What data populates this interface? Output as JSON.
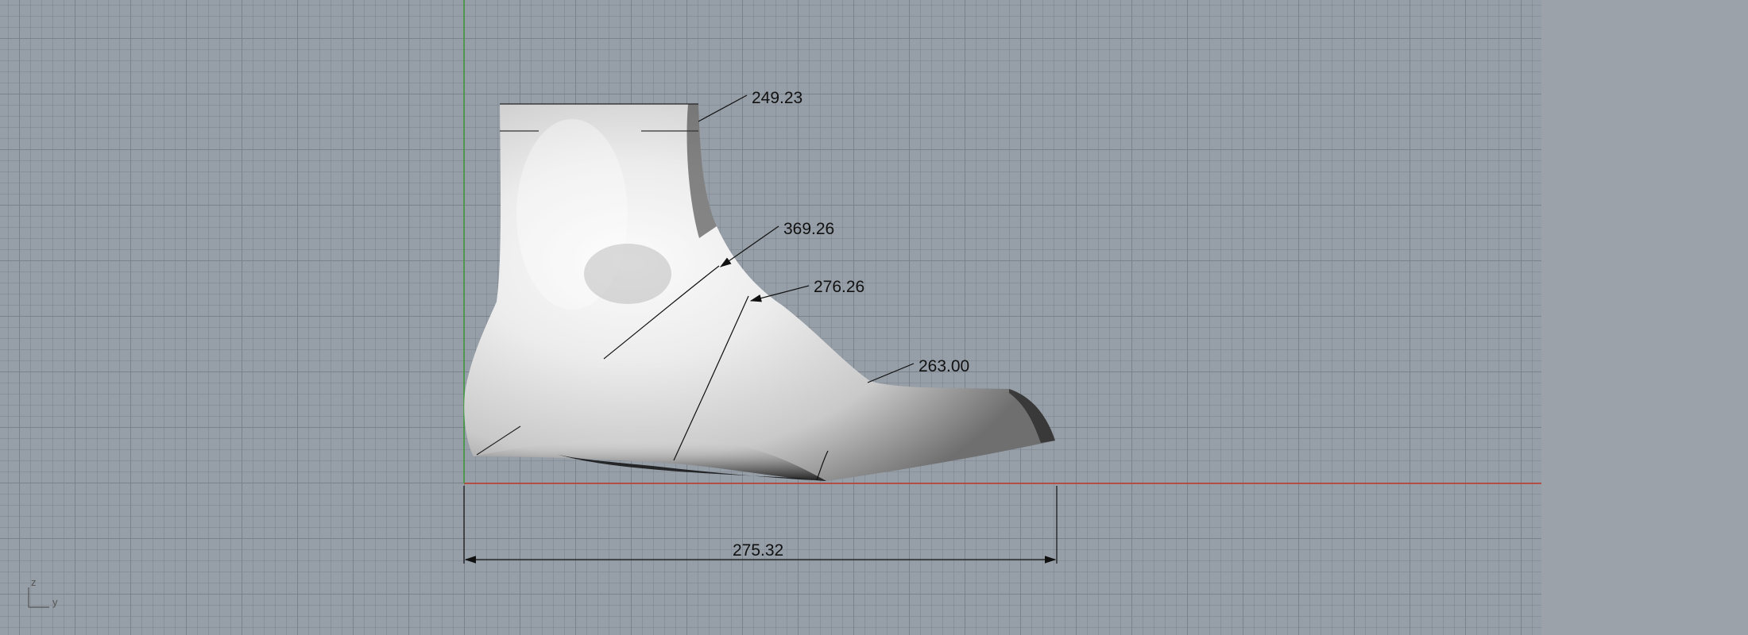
{
  "viewport": {
    "axis_x_color": "#c0392b",
    "axis_y_color": "#3a9a3a"
  },
  "dimensions": {
    "top_girth": "249.23",
    "instep_girth": "369.26",
    "waist_girth": "276.26",
    "ball_girth": "263.00",
    "length": "275.32"
  },
  "corner_axes": {
    "z_label": "z",
    "y_label": "y"
  }
}
